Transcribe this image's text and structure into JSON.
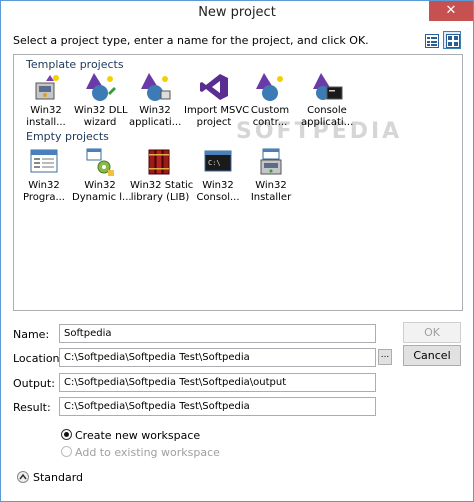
{
  "window": {
    "title": "New project",
    "close_symbol": "✕"
  },
  "instruction": "Select a project type, enter a name for the project, and click OK.",
  "view_buttons": [
    "details-view-icon",
    "large-icons-view-icon"
  ],
  "watermark": "SOFTPEDIA",
  "groups": {
    "template_label": "Template projects",
    "empty_label": "Empty projects"
  },
  "template_items": [
    {
      "line1": "Win32",
      "line2": "install...",
      "icon": "installer-wizard-icon"
    },
    {
      "line1": "Win32 DLL",
      "line2": "wizard",
      "icon": "wizard-icon"
    },
    {
      "line1": "Win32",
      "line2": "applicati...",
      "icon": "wizard-icon"
    },
    {
      "line1": "Import MSVC",
      "line2": "project",
      "icon": "visual-studio-icon"
    },
    {
      "line1": "Custom",
      "line2": "contr...",
      "icon": "wizard-icon"
    },
    {
      "line1": "Console",
      "line2": "applicati...",
      "icon": "console-wizard-icon"
    }
  ],
  "empty_items": [
    {
      "line1": "Win32",
      "line2": "Progra...",
      "icon": "window-icon"
    },
    {
      "line1": "Win32",
      "line2": "Dynamic l...",
      "icon": "dll-icon"
    },
    {
      "line1": "Win32 Static",
      "line2": "library (LIB)",
      "icon": "books-icon"
    },
    {
      "line1": "Win32",
      "line2": "Consol...",
      "icon": "console-icon"
    },
    {
      "line1": "Win32",
      "line2": "Installer",
      "icon": "installer-icon"
    }
  ],
  "fields": {
    "name_label": "Name:",
    "name_value": "Softpedia",
    "location_label": "Location:",
    "location_value": "C:\\Softpedia\\Softpedia Test\\Softpedia",
    "output_label": "Output:",
    "output_value": "C:\\Softpedia\\Softpedia Test\\Softpedia\\output",
    "result_label": "Result:",
    "result_value": "C:\\Softpedia\\Softpedia Test\\Softpedia",
    "browse_label": "..."
  },
  "buttons": {
    "ok": "OK",
    "cancel": "Cancel"
  },
  "workspace": {
    "create_new": "Create new workspace",
    "add_existing": "Add to existing workspace"
  },
  "standard_label": "Standard",
  "colors": {
    "accent_border": "#5b9bd5",
    "close_red": "#c75050",
    "group_label": "#1e395b"
  }
}
